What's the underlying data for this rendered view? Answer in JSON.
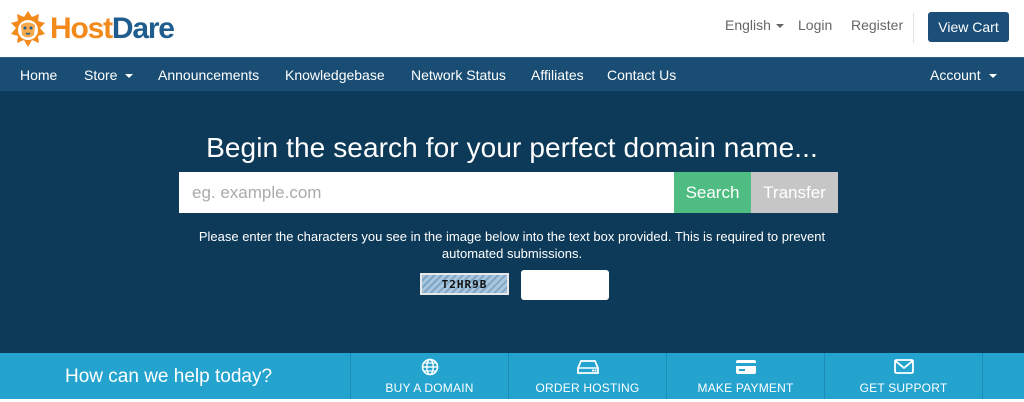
{
  "header": {
    "logo_host": "Host",
    "logo_dare": "Dare",
    "language": "English",
    "login": "Login",
    "register": "Register",
    "view_cart": "View Cart"
  },
  "nav": {
    "items": [
      {
        "label": "Home"
      },
      {
        "label": "Store"
      },
      {
        "label": "Announcements"
      },
      {
        "label": "Knowledgebase"
      },
      {
        "label": "Network Status"
      },
      {
        "label": "Affiliates"
      },
      {
        "label": "Contact Us"
      }
    ],
    "account": "Account"
  },
  "hero": {
    "title": "Begin the search for your perfect domain name...",
    "search_placeholder": "eg. example.com",
    "search_button": "Search",
    "transfer_button": "Transfer",
    "captcha_message": "Please enter the characters you see in the image below into the text box provided. This is required to prevent automated submissions.",
    "captcha_code": "T2HR9B"
  },
  "helpbar": {
    "prompt": "How can we help today?",
    "items": [
      {
        "label": "BUY A DOMAIN",
        "icon": "globe-icon"
      },
      {
        "label": "ORDER HOSTING",
        "icon": "server-icon"
      },
      {
        "label": "MAKE PAYMENT",
        "icon": "credit-card-icon"
      },
      {
        "label": "GET SUPPORT",
        "icon": "envelope-icon"
      }
    ]
  },
  "colors": {
    "brand_orange": "#f28a1c",
    "brand_blue": "#1f5d8e",
    "nav_bg": "#1a4d74",
    "hero_bg": "#0e3a59",
    "search_green": "#4fbd81",
    "transfer_gray": "#c6c6c6",
    "helpbar_bg": "#24a3cf"
  }
}
